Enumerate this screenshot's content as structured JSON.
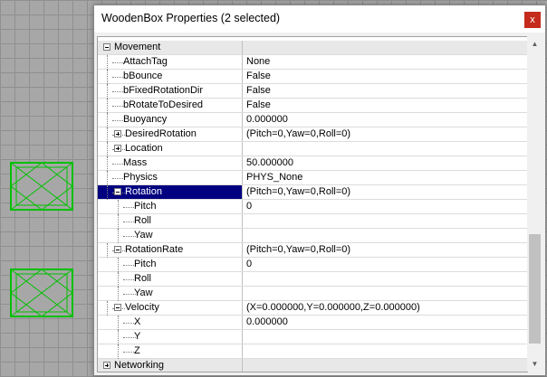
{
  "window": {
    "title": "WoodenBox Properties (2 selected)",
    "close_label": "x"
  },
  "rows": [
    {
      "name": "Movement",
      "value": "",
      "type": "category",
      "expander": "minus",
      "level": 0
    },
    {
      "name": "AttachTag",
      "value": "None",
      "level": 1
    },
    {
      "name": "bBounce",
      "value": "False",
      "level": 1
    },
    {
      "name": "bFixedRotationDir",
      "value": "False",
      "level": 1
    },
    {
      "name": "bRotateToDesired",
      "value": "False",
      "level": 1
    },
    {
      "name": "Buoyancy",
      "value": "0.000000",
      "level": 1
    },
    {
      "name": "DesiredRotation",
      "value": "(Pitch=0,Yaw=0,Roll=0)",
      "expander": "plus",
      "level": 1
    },
    {
      "name": "Location",
      "value": "",
      "expander": "plus",
      "level": 1
    },
    {
      "name": "Mass",
      "value": "50.000000",
      "level": 1
    },
    {
      "name": "Physics",
      "value": "PHYS_None",
      "level": 1
    },
    {
      "name": "Rotation",
      "value": "(Pitch=0,Yaw=0,Roll=0)",
      "expander": "minus",
      "level": 1,
      "selected": true
    },
    {
      "name": "Pitch",
      "value": "0",
      "level": 2
    },
    {
      "name": "Roll",
      "value": "",
      "level": 2
    },
    {
      "name": "Yaw",
      "value": "",
      "level": 2
    },
    {
      "name": "RotationRate",
      "value": "(Pitch=0,Yaw=0,Roll=0)",
      "expander": "minus",
      "level": 1
    },
    {
      "name": "Pitch",
      "value": "0",
      "level": 2
    },
    {
      "name": "Roll",
      "value": "",
      "level": 2
    },
    {
      "name": "Yaw",
      "value": "",
      "level": 2
    },
    {
      "name": "Velocity",
      "value": "(X=0.000000,Y=0.000000,Z=0.000000)",
      "expander": "minus",
      "level": 1
    },
    {
      "name": "X",
      "value": "0.000000",
      "level": 2
    },
    {
      "name": "Y",
      "value": "",
      "level": 2
    },
    {
      "name": "Z",
      "value": "",
      "level": 2
    },
    {
      "name": "Networking",
      "value": "",
      "type": "category",
      "expander": "plus",
      "level": 0
    }
  ],
  "scrollbar": {
    "up_icon": "scroll-up-icon",
    "down_icon": "scroll-down-icon"
  },
  "colors": {
    "selection": "#000080",
    "wireframe": "#00c000",
    "close": "#c42b1c"
  }
}
